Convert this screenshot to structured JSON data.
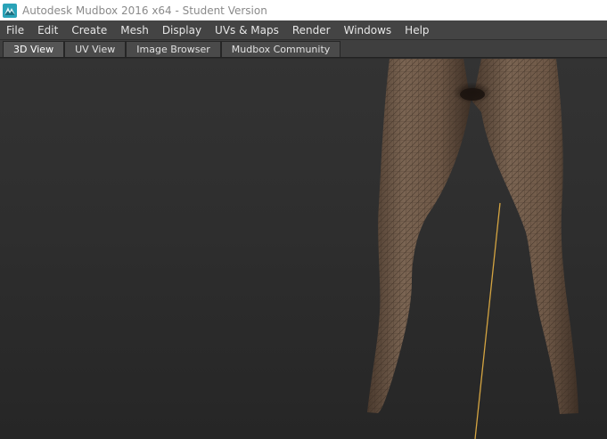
{
  "window": {
    "title": "Autodesk Mudbox 2016 x64 - Student Version",
    "icon": "mudbox-logo-icon"
  },
  "menu": [
    "File",
    "Edit",
    "Create",
    "Mesh",
    "Display",
    "UVs & Maps",
    "Render",
    "Windows",
    "Help"
  ],
  "tabs": [
    {
      "label": "3D View",
      "active": true
    },
    {
      "label": "UV View",
      "active": false
    },
    {
      "label": "Image Browser",
      "active": false
    },
    {
      "label": "Mudbox Community",
      "active": false
    }
  ],
  "viewport": {
    "content": "mesh-legs-model",
    "colors": {
      "background": "#2b2b2b",
      "mesh": "#6f5a48",
      "wire": "#3a2d23",
      "line": "#d4a441"
    }
  }
}
